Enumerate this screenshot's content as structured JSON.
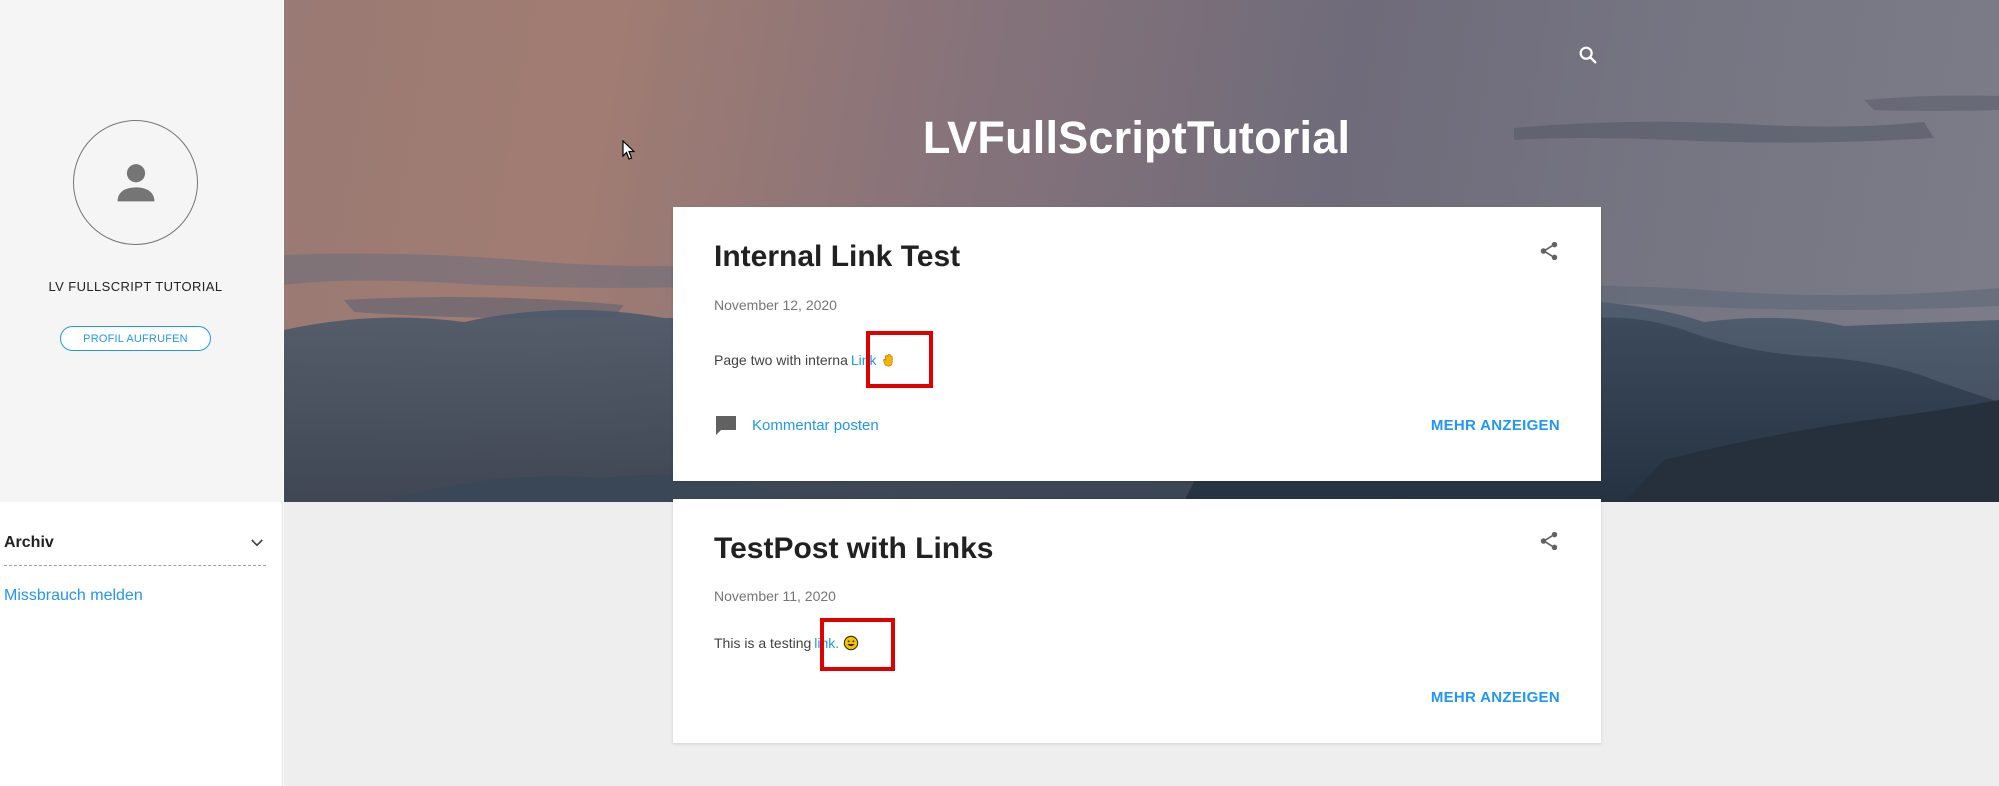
{
  "blog": {
    "title": "LVFullScriptTutorial"
  },
  "profile": {
    "name": "LV FULLSCRIPT TUTORIAL",
    "button_label": "PROFIL AUFRUFEN"
  },
  "sidebar": {
    "archive_label": "Archiv",
    "report_link": "Missbrauch melden"
  },
  "icons": {
    "search": "search-icon",
    "share": "share-icon",
    "comment": "comment-icon",
    "avatar": "person-icon",
    "chevron": "chevron-down-icon"
  },
  "colors": {
    "accent": "#2196f3",
    "highlight": "#e00000"
  },
  "posts": [
    {
      "title": "Internal Link Test",
      "date": "November 12, 2020",
      "body_text": "Page two with interna",
      "link_text": "Link",
      "comment_label": "Kommentar posten",
      "more_label": "MEHR ANZEIGEN"
    },
    {
      "title": "TestPost with Links",
      "date": "November 11, 2020",
      "body_text": "This is a testing",
      "link_text": "link.",
      "more_label": "MEHR ANZEIGEN"
    }
  ]
}
